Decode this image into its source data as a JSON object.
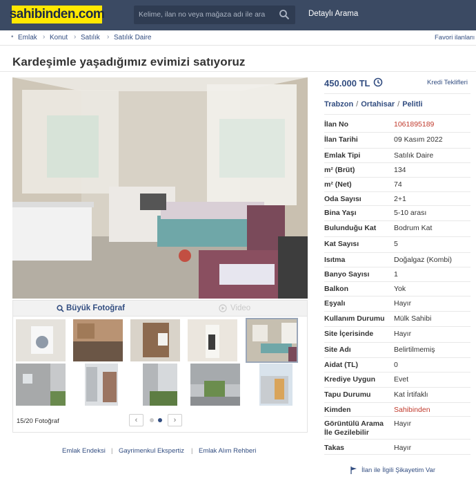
{
  "header": {
    "logo": "sahibinden.com",
    "search_placeholder": "Kelime, ilan no veya mağaza adı ile ara",
    "advanced_search": "Detaylı Arama"
  },
  "breadcrumb": {
    "items": [
      "Emlak",
      "Konut",
      "Satılık",
      "Satılık Daire"
    ],
    "favorites": "Favori ilanlarım"
  },
  "listing": {
    "title": "Kardeşimle yaşadığımız evimizi satıyoruz",
    "price": "450.000 TL",
    "credit_offers": "Kredi Teklifleri",
    "location": [
      "Trabzon",
      "Ortahisar",
      "Pelitli"
    ]
  },
  "gallery": {
    "big_photo": "Büyük Fotoğraf",
    "video": "Video",
    "counter": "15/20 Fotoğraf",
    "prev": "‹",
    "next": "›"
  },
  "details": [
    {
      "label": "İlan No",
      "value": "1061895189",
      "highlight": true
    },
    {
      "label": "İlan Tarihi",
      "value": "09 Kasım 2022"
    },
    {
      "label": "Emlak Tipi",
      "value": "Satılık Daire"
    },
    {
      "label": "m² (Brüt)",
      "value": "134"
    },
    {
      "label": "m² (Net)",
      "value": "74"
    },
    {
      "label": "Oda Sayısı",
      "value": "2+1"
    },
    {
      "label": "Bina Yaşı",
      "value": "5-10 arası"
    },
    {
      "label": "Bulunduğu Kat",
      "value": "Bodrum Kat"
    },
    {
      "label": "Kat Sayısı",
      "value": "5"
    },
    {
      "label": "Isıtma",
      "value": "Doğalgaz (Kombi)"
    },
    {
      "label": "Banyo Sayısı",
      "value": "1"
    },
    {
      "label": "Balkon",
      "value": "Yok"
    },
    {
      "label": "Eşyalı",
      "value": "Hayır"
    },
    {
      "label": "Kullanım Durumu",
      "value": "Mülk Sahibi"
    },
    {
      "label": "Site İçerisinde",
      "value": "Hayır"
    },
    {
      "label": "Site Adı",
      "value": "Belirtilmemiş"
    },
    {
      "label": "Aidat (TL)",
      "value": "0"
    },
    {
      "label": "Krediye Uygun",
      "value": "Evet"
    },
    {
      "label": "Tapu Durumu",
      "value": "Kat İrtifaklı"
    },
    {
      "label": "Kimden",
      "value": "Sahibinden",
      "highlight": true
    },
    {
      "label": "Görüntülü Arama İle Gezilebilir",
      "value": "Hayır"
    },
    {
      "label": "Takas",
      "value": "Hayır"
    }
  ],
  "footer": {
    "links": [
      "Emlak Endeksi",
      "Gayrimenkul Ekspertiz",
      "Emlak Alım Rehberi"
    ],
    "complaint": "İlan ile İlgili Şikayetim Var"
  },
  "colors": {
    "header_bg": "#3b4a63",
    "logo_bg": "#ffe800",
    "link": "#324d80",
    "highlight": "#c0392b"
  }
}
